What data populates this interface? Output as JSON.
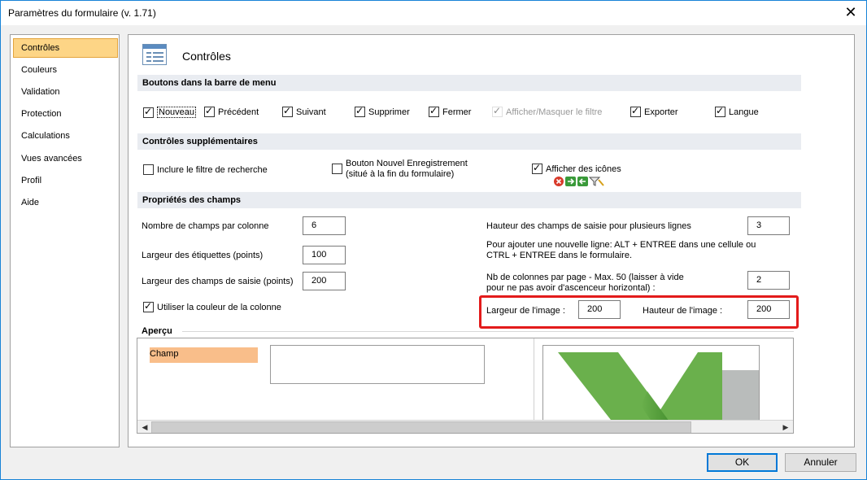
{
  "window": {
    "title": "Paramètres du formulaire (v. 1.71)",
    "close_glyph": "✕"
  },
  "sidebar": {
    "items": [
      {
        "label": "Contrôles",
        "active": true
      },
      {
        "label": "Couleurs"
      },
      {
        "label": "Validation"
      },
      {
        "label": "Protection"
      },
      {
        "label": "Calculations"
      },
      {
        "label": "Vues avancées"
      },
      {
        "label": "Profil"
      },
      {
        "label": "Aide"
      }
    ]
  },
  "main": {
    "title": "Contrôles",
    "menu_section": {
      "heading": "Boutons dans la barre de menu",
      "items": [
        {
          "label": "Nouveau",
          "checked": true
        },
        {
          "label": "Précédent",
          "checked": true
        },
        {
          "label": "Suivant",
          "checked": true
        },
        {
          "label": "Supprimer",
          "checked": true
        },
        {
          "label": "Fermer",
          "checked": true
        },
        {
          "label": "Afficher/Masquer le filtre",
          "checked": true,
          "disabled": true
        },
        {
          "label": "Exporter",
          "checked": true
        },
        {
          "label": "Langue",
          "checked": true
        }
      ]
    },
    "extra_section": {
      "heading": "Contrôles supplémentaires",
      "include_search_filter": "Inclure le filtre de recherche",
      "new_record_button_line1": "Bouton Nouvel Enregistrement",
      "new_record_button_line2": "(situé à la fin du formulaire)",
      "show_icons": "Afficher des icônes"
    },
    "fields_section": {
      "heading": "Propriétés des champs",
      "fields_per_column_label": "Nombre de champs par colonne",
      "fields_per_column_value": "6",
      "label_width_label": "Largeur des étiquettes (points)",
      "label_width_value": "100",
      "input_width_label": "Largeur des champs de saisie (points)",
      "input_width_value": "200",
      "use_column_color": "Utiliser la couleur de la colonne",
      "multiline_height_label": "Hauteur des champs de saisie pour plusieurs lignes",
      "multiline_height_value": "3",
      "new_line_hint_1": "Pour ajouter une nouvelle ligne: ALT + ENTREE dans une cellule ou",
      "new_line_hint_2": "CTRL + ENTREE dans le formulaire.",
      "columns_per_page_label_1": "Nb de colonnes par page - Max. 50 (laisser à vide",
      "columns_per_page_label_2": "pour ne pas avoir d'ascenceur horizontal) :",
      "columns_per_page_value": "2",
      "image_width_label": "Largeur de l'image :",
      "image_width_value": "200",
      "image_height_label": "Hauteur de l'image :",
      "image_height_value": "200"
    },
    "preview": {
      "heading": "Aperçu",
      "field_label": "Champ"
    }
  },
  "footer": {
    "ok_label": "OK",
    "cancel_label": "Annuler"
  },
  "colors": {
    "accent": "#0078d7",
    "highlight": "#e31b1b",
    "active_item": "#fdd586",
    "preview_label_bg": "#f9be8a",
    "logo_green": "#6ab04c"
  }
}
